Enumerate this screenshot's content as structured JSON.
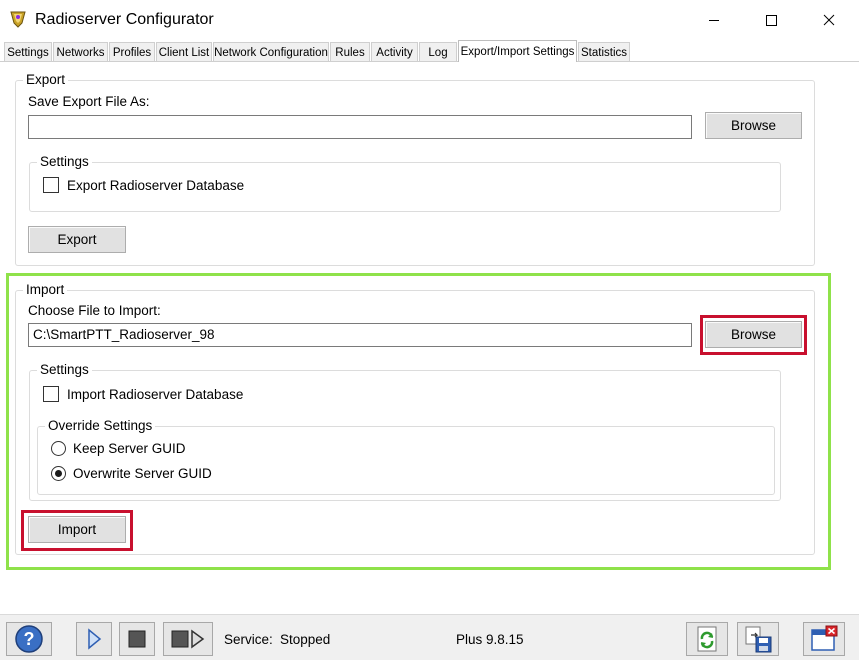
{
  "window": {
    "title": "Radioserver Configurator",
    "icon": "radioserver-app-icon"
  },
  "tabs": [
    {
      "label": "Settings",
      "active": false
    },
    {
      "label": "Networks",
      "active": false
    },
    {
      "label": "Profiles",
      "active": false
    },
    {
      "label": "Client List",
      "active": false
    },
    {
      "label": "Network Configuration",
      "active": false
    },
    {
      "label": "Rules",
      "active": false
    },
    {
      "label": "Activity",
      "active": false
    },
    {
      "label": "Log",
      "active": false
    },
    {
      "label": "Export/Import Settings",
      "active": true
    },
    {
      "label": "Statistics",
      "active": false
    }
  ],
  "export": {
    "group_label": "Export",
    "file_label": "Save Export File As:",
    "file_value": "",
    "browse_label": "Browse",
    "settings_label": "Settings",
    "db_checkbox_label": "Export Radioserver Database",
    "db_checked": false,
    "action_label": "Export"
  },
  "import": {
    "group_label": "Import",
    "file_label": "Choose File to Import:",
    "file_value": "C:\\SmartPTT_Radioserver_98",
    "browse_label": "Browse",
    "settings_label": "Settings",
    "db_checkbox_label": "Import Radioserver Database",
    "db_checked": false,
    "override_label": "Override Settings",
    "override_options": [
      {
        "label": "Keep Server GUID",
        "checked": false
      },
      {
        "label": "Overwrite Server GUID",
        "checked": true
      }
    ],
    "action_label": "Import"
  },
  "status": {
    "service_label": "Service:",
    "service_state": "Stopped",
    "version": "Plus 9.8.15"
  },
  "highlight_colors": {
    "section": "#8fe24a",
    "target": "#c8102e"
  }
}
